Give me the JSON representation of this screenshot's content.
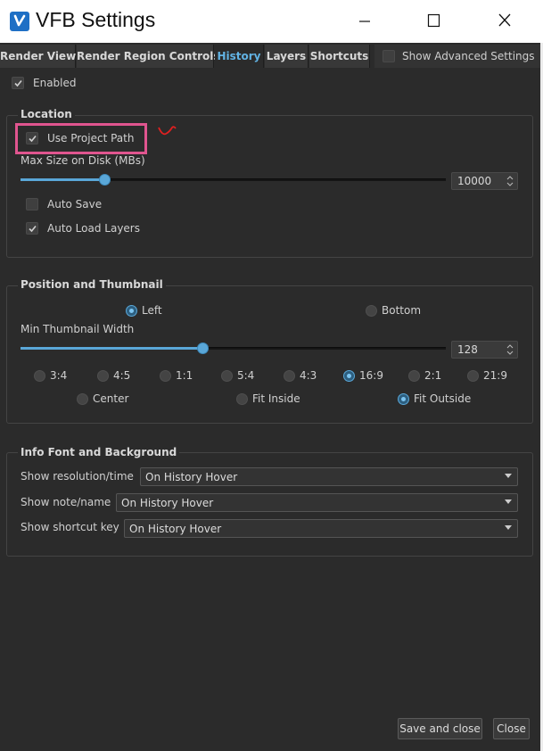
{
  "window": {
    "title": "VFB Settings",
    "controls": [
      "minimize",
      "maximize",
      "close"
    ]
  },
  "tabs": [
    {
      "label": "Render View",
      "active": false
    },
    {
      "label": "Render Region Controls",
      "active": false
    },
    {
      "label": "History",
      "active": true
    },
    {
      "label": "Layers",
      "active": false
    },
    {
      "label": "Shortcuts",
      "active": false
    }
  ],
  "advanced": {
    "label": "Show Advanced Settings",
    "checked": false
  },
  "enabled": {
    "label": "Enabled",
    "checked": true
  },
  "location": {
    "title": "Location",
    "use_project_path": {
      "label": "Use Project Path",
      "checked": true
    },
    "max_size_label": "Max Size on Disk (MBs)",
    "max_size_value": "10000",
    "max_size_slider_fraction": 0.2,
    "auto_save": {
      "label": "Auto Save",
      "checked": false
    },
    "auto_load_layers": {
      "label": "Auto Load Layers",
      "checked": true
    }
  },
  "position": {
    "title": "Position and Thumbnail",
    "side_options": [
      {
        "label": "Left",
        "selected": true
      },
      {
        "label": "Bottom",
        "selected": false
      }
    ],
    "min_width_label": "Min Thumbnail Width",
    "min_width_value": "128",
    "min_width_slider_fraction": 0.43,
    "ratios": [
      {
        "label": "3:4",
        "selected": false
      },
      {
        "label": "4:5",
        "selected": false
      },
      {
        "label": "1:1",
        "selected": false
      },
      {
        "label": "5:4",
        "selected": false
      },
      {
        "label": "4:3",
        "selected": false
      },
      {
        "label": "16:9",
        "selected": true
      },
      {
        "label": "2:1",
        "selected": false
      },
      {
        "label": "21:9",
        "selected": false
      }
    ],
    "fit_options": [
      {
        "label": "Center",
        "selected": false
      },
      {
        "label": "Fit Inside",
        "selected": false
      },
      {
        "label": "Fit Outside",
        "selected": true
      }
    ]
  },
  "info": {
    "title": "Info Font and Background",
    "rows": [
      {
        "label": "Show resolution/time",
        "value": "On History Hover"
      },
      {
        "label": "Show note/name",
        "value": "On History Hover"
      },
      {
        "label": "Show shortcut key",
        "value": "On History Hover"
      }
    ]
  },
  "footer": {
    "save_label": "Save and close",
    "close_label": "Close"
  },
  "colors": {
    "accent": "#5aa7d8",
    "background": "#2b2b2b",
    "annotation_box": "#e0558f",
    "annotation_mark": "#e02020"
  }
}
